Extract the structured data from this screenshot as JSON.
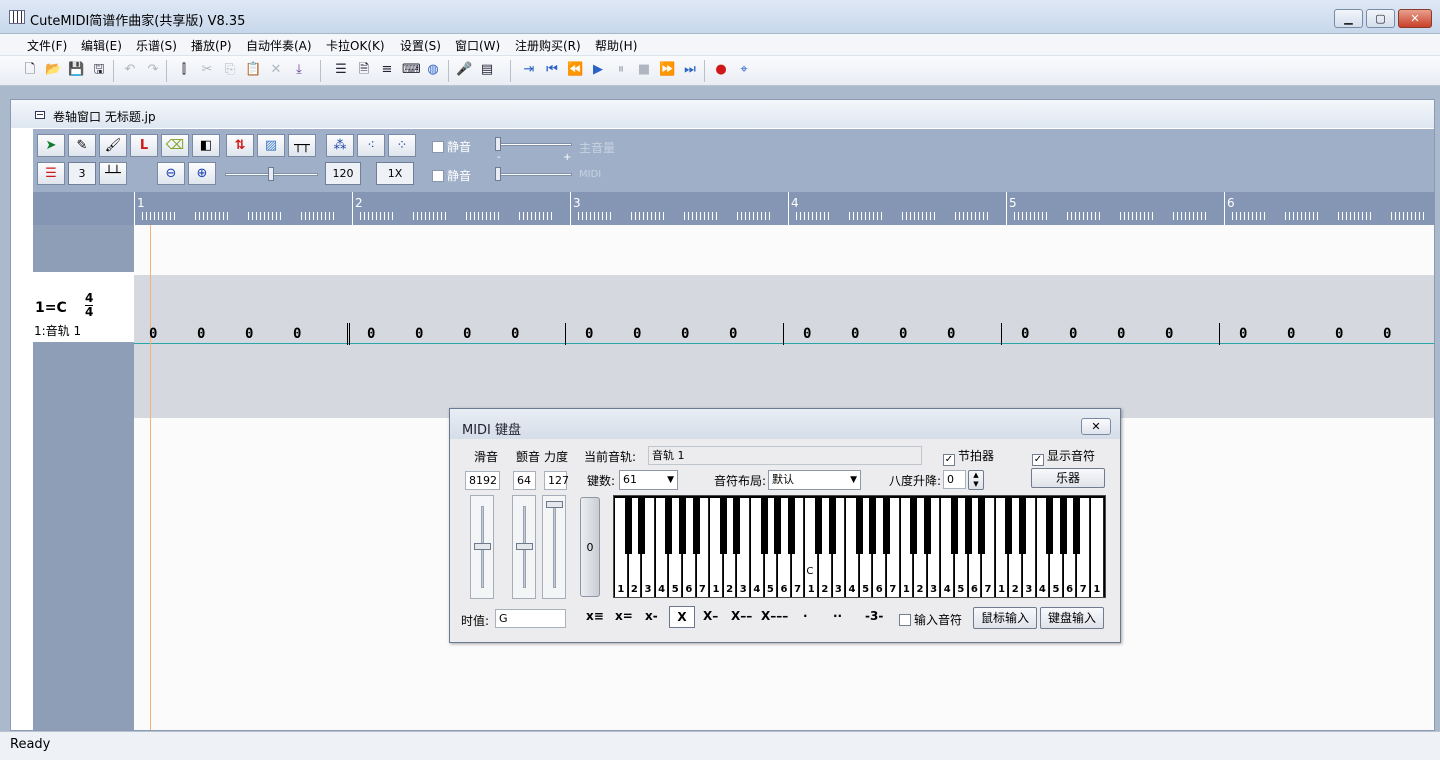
{
  "window": {
    "title": "CuteMIDI简谱作曲家(共享版) V8.35"
  },
  "menu": [
    "文件(F)",
    "编辑(E)",
    "乐谱(S)",
    "播放(P)",
    "自动伴奏(A)",
    "卡拉OK(K)",
    "设置(S)",
    "窗口(W)",
    "注册购买(R)",
    "帮助(H)"
  ],
  "child": {
    "title": "卷轴窗口  无标题.jp"
  },
  "roll_toolbar": {
    "snap_value": "3",
    "tempo": "120",
    "speed": "1X",
    "mute_label": "静音",
    "main_volume_label": "主音量",
    "midi_label": "MIDI",
    "minus": "-",
    "plus": "+"
  },
  "ruler": {
    "bars": [
      "1",
      "2",
      "3",
      "4",
      "5",
      "6"
    ]
  },
  "track": {
    "key": "1=C",
    "time_top": "4",
    "time_bottom": "4",
    "name": "1:音轨  1"
  },
  "notes": [
    "0",
    "0",
    "0",
    "0",
    "0",
    "0",
    "0",
    "0",
    "0",
    "0",
    "0",
    "0",
    "0",
    "0",
    "0",
    "0",
    "0",
    "0",
    "0",
    "0",
    "0",
    "0",
    "0",
    "0"
  ],
  "status": {
    "text": "Ready"
  },
  "midi_dialog": {
    "title": "MIDI 键盘",
    "glide_label": "滑音",
    "vibrato_label": "颤音",
    "velocity_label": "力度",
    "glide_value": "8192",
    "vibrato_value": "64",
    "velocity_value": "127",
    "velocity_bar_value": "0",
    "current_track_label": "当前音轨:",
    "current_track_value": "音轨 1",
    "metronome_label": "节拍器",
    "show_notes_label": "显示音符",
    "keys_label": "键数:",
    "keys_value": "61",
    "layout_label": "音符布局:",
    "layout_value": "默认",
    "octave_label": "八度升降:",
    "octave_value": "0",
    "instrument_button": "乐器",
    "duration_label": "时值:",
    "duration_value": "G",
    "input_notes_label": "输入音符",
    "mouse_input_button": "鼠标输入",
    "keyboard_input_button": "键盘输入",
    "key_labels": [
      "1",
      "2",
      "3",
      "4",
      "5",
      "6",
      "7",
      "1",
      "2",
      "3",
      "4",
      "5",
      "6",
      "7",
      "1",
      "2",
      "3",
      "4",
      "5",
      "6",
      "7",
      "1",
      "2",
      "3",
      "4",
      "5",
      "6",
      "7",
      "1",
      "2",
      "3",
      "4",
      "5",
      "6",
      "7",
      "1"
    ],
    "middle_c_mark": "C",
    "durations": [
      "x≡",
      "x=",
      "x-",
      "X",
      "X–",
      "X––",
      "X–––",
      "·",
      "··",
      "-3-"
    ]
  }
}
